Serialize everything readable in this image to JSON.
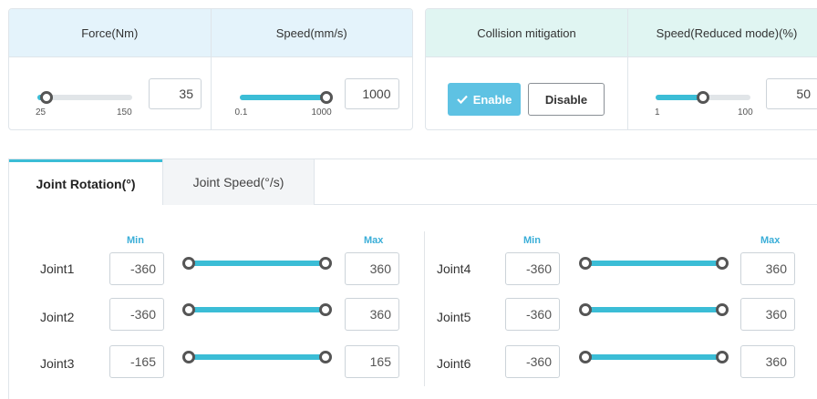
{
  "settings_panel": {
    "force": {
      "label": "Force(Nm)",
      "value": "35",
      "min": "25",
      "max": "150",
      "fraction": 0.1
    },
    "speed": {
      "label": "Speed(mm/s)",
      "value": "1000",
      "min": "0.1",
      "max": "1000",
      "fraction": 1.0
    }
  },
  "collision_panel": {
    "collision_label": "Collision mitigation",
    "enable_label": "Enable",
    "disable_label": "Disable",
    "reduced_speed": {
      "label": "Speed(Reduced mode)(%)",
      "value": "50",
      "min": "1",
      "max": "100",
      "fraction": 0.5
    }
  },
  "tabs": [
    {
      "label": "Joint Rotation(°)",
      "active": true
    },
    {
      "label": "Joint Speed(°/s)",
      "active": false
    }
  ],
  "joint_headers": {
    "min": "Min",
    "max": "Max"
  },
  "joints": [
    {
      "name": "Joint1",
      "min": "-360",
      "max": "360"
    },
    {
      "name": "Joint2",
      "min": "-360",
      "max": "360"
    },
    {
      "name": "Joint3",
      "min": "-165",
      "max": "165"
    },
    {
      "name": "Joint4",
      "min": "-360",
      "max": "360"
    },
    {
      "name": "Joint5",
      "min": "-360",
      "max": "360"
    },
    {
      "name": "Joint6",
      "min": "-360",
      "max": "360"
    }
  ],
  "colors": {
    "accent": "#3bbdd6",
    "enable_button": "#5ec2e3",
    "header_blue": "#e4f3fb",
    "header_green": "#e0f5f2"
  }
}
